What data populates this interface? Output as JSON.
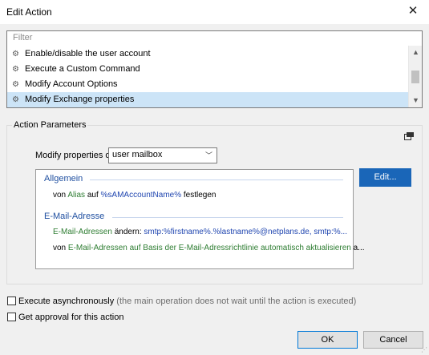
{
  "window": {
    "title": "Edit Action",
    "close_glyph": "✕"
  },
  "filter": {
    "placeholder": "Filter"
  },
  "actions": {
    "items": [
      {
        "label": "Enable/disable the user account",
        "selected": false
      },
      {
        "label": "Execute a Custom Command",
        "selected": false
      },
      {
        "label": "Modify Account Options",
        "selected": false
      },
      {
        "label": "Modify Exchange properties",
        "selected": true
      }
    ],
    "scroll_up": "▲",
    "scroll_down": "▼",
    "icon": "gear-icon"
  },
  "params": {
    "group_label": "Action Parameters",
    "modify_label": "Modify properties of",
    "target_value": "user mailbox",
    "allgemein": {
      "heading": "Allgemein",
      "line": [
        "von ",
        "Alias",
        " auf ",
        "%sAMAccountName%",
        " festlegen"
      ]
    },
    "email": {
      "heading": "E-Mail-Adresse",
      "line1": [
        "E-Mail-Adressen",
        " ändern: ",
        "smtp:%firstname%.%lastname%@netplans.de, smtp:%..."
      ],
      "line2": [
        "von ",
        "E-Mail-Adressen auf Basis der E-Mail-Adressrichtlinie automatisch aktualisieren",
        " a..."
      ]
    },
    "edit_button": "Edit..."
  },
  "options": {
    "async_label": "Execute asynchronously",
    "async_hint": "(the main operation does not wait until the action is executed)",
    "approval_label": "Get approval for this action"
  },
  "buttons": {
    "ok": "OK",
    "cancel": "Cancel"
  },
  "colors": {
    "selection": "#cce4f7",
    "accent": "#1a66b8",
    "heading_blue": "#1f4fa0",
    "property_green": "#2e7d32",
    "value_blue": "#2046b0"
  }
}
